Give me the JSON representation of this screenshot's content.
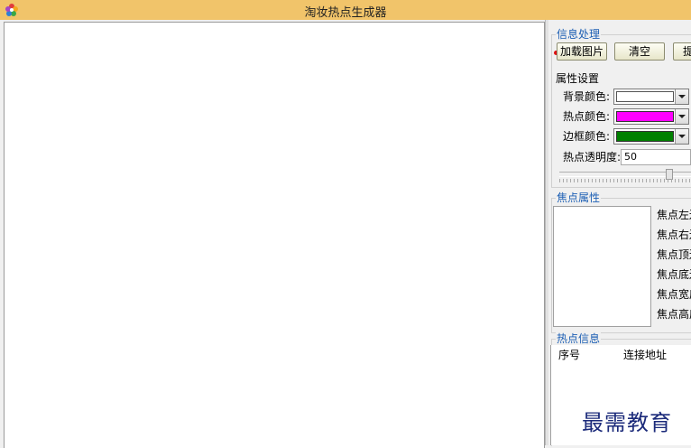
{
  "window": {
    "title": "淘妆热点生成器",
    "icon": "colorful-flower-app-icon"
  },
  "info_group": {
    "title": "信息处理",
    "buttons": [
      {
        "label": "加载图片"
      },
      {
        "label": "清空"
      },
      {
        "label": "提"
      }
    ]
  },
  "attr_group": {
    "title": "属性设置",
    "bg_color": {
      "label": "背景颜色:",
      "value": "#ffffff"
    },
    "hot_color": {
      "label": "热点颜色:",
      "value": "#ff00ff"
    },
    "border_color": {
      "label": "边框颜色:",
      "value": "#008000"
    },
    "opacity": {
      "label": "热点透明度:",
      "value": "50"
    }
  },
  "focus_group": {
    "title": "焦点属性",
    "labels": [
      "焦点左边",
      "焦点右边",
      "焦点顶边",
      "焦点底边",
      "焦点宽度",
      "焦点高度"
    ]
  },
  "hotspot_group": {
    "title": "热点信息",
    "columns": [
      "序号",
      "连接地址"
    ]
  },
  "watermark": "最需教育",
  "colors": {
    "titlebar": "#f1c46a",
    "group_title": "#1d5fb4",
    "watermark": "#1b2a7a"
  }
}
